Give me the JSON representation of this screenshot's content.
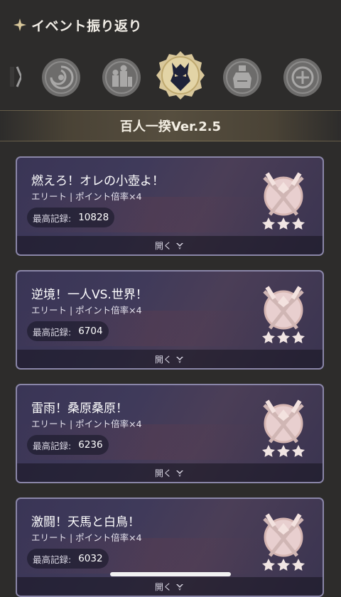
{
  "header": {
    "title": "イベント振り返り",
    "icon": "sparkle-icon"
  },
  "event_icons": [
    {
      "name": "arrow-left-icon"
    },
    {
      "name": "event-icon-swirl"
    },
    {
      "name": "event-icon-figures"
    },
    {
      "name": "event-icon-demon-mask",
      "active": true
    },
    {
      "name": "event-icon-bottle"
    },
    {
      "name": "event-icon-compass"
    }
  ],
  "banner": {
    "title": "百人一揆Ver.2.5"
  },
  "cards": [
    {
      "name": "燃えろ！オレの小壺よ！",
      "subtitle": "エリート | ポイント倍率×4",
      "record_label": "最高記録:",
      "record_value": "10828",
      "open_label": "開く",
      "stars": 3
    },
    {
      "name": "逆境！一人VS.世界！",
      "subtitle": "エリート | ポイント倍率×4",
      "record_label": "最高記録:",
      "record_value": "6704",
      "open_label": "開く",
      "stars": 3
    },
    {
      "name": "雷雨！桑原桑原！",
      "subtitle": "エリート | ポイント倍率×4",
      "record_label": "最高記録:",
      "record_value": "6236",
      "open_label": "開く",
      "stars": 3
    },
    {
      "name": "激闘！天馬と白鳥！",
      "subtitle": "エリート | ポイント倍率×4",
      "record_label": "最高記録:",
      "record_value": "6032",
      "open_label": "開く",
      "stars": 3
    }
  ],
  "colors": {
    "background": "#2d2c2b",
    "accent_gold": "#d8c79a",
    "card_border": "#8a86a8"
  }
}
